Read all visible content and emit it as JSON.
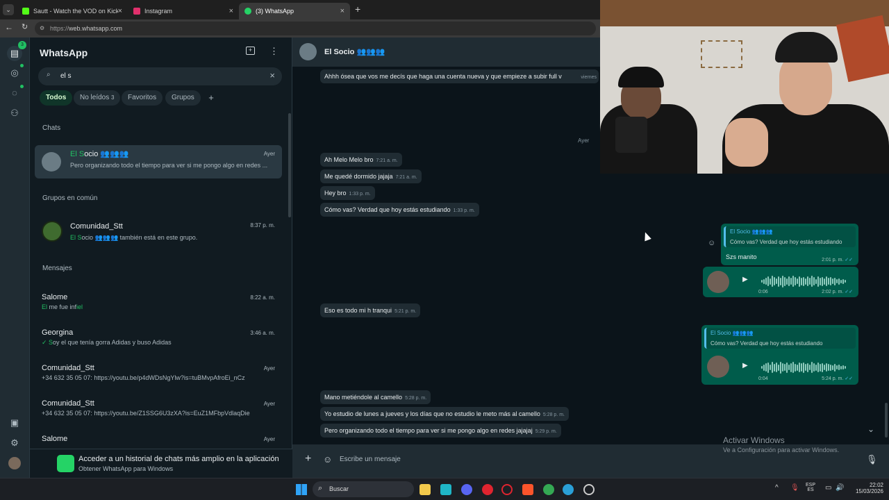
{
  "browser": {
    "tabs": [
      {
        "label": "Sautt - Watch the VOD on Kick",
        "color": "#53fc18"
      },
      {
        "label": "Instagram",
        "color": "#e1306c"
      },
      {
        "label": "(3) WhatsApp",
        "color": "#25d366"
      }
    ],
    "url_prefix": "https://",
    "url_host": "web.whatsapp.com"
  },
  "rail": {
    "badge": "3"
  },
  "sidebar": {
    "title": "WhatsApp",
    "search_value": "el s",
    "filters": [
      {
        "label": "Todos"
      },
      {
        "label": "No leídos",
        "count": "3"
      },
      {
        "label": "Favoritos"
      },
      {
        "label": "Grupos"
      }
    ],
    "sections": {
      "chats": "Chats",
      "groups": "Grupos en común",
      "messages": "Mensajes"
    },
    "chats": [
      {
        "name_hl": "El S",
        "name_rest": "ocio 👥👥👥",
        "time": "Ayer",
        "preview": "Pero organizando todo el tiempo para ver si me pongo algo en redes ..."
      }
    ],
    "groups": [
      {
        "name": "Comunidad_Stt",
        "time": "8:37 p. m.",
        "preview_hl": "El S",
        "preview_mid": "ocio 👥👥👥",
        "preview_rest": " también está en este grupo."
      }
    ],
    "messages": [
      {
        "name": "Salome",
        "time": "8:22 a. m.",
        "p1": "El",
        "p2": " me fue inf",
        "p3": "iel"
      },
      {
        "name": "Georgina",
        "time": "3:46 a. m.",
        "p1": "✓ S",
        "p2": "oy el que tenía gorra Adidas y buso Adidas",
        "p3": ""
      },
      {
        "name": "Comunidad_Stt",
        "time": "Ayer",
        "p1": "+34 632 35 05 07: https://youtu.be/p4dWDsNgYlw?is=tuBMvpAfroEi_nCz",
        "p2": "",
        "p3": ""
      },
      {
        "name": "Comunidad_Stt",
        "time": "Ayer",
        "p1": "+34 632 35 05 07: https://youtu.be/Z1SSG6U3zXA?is=EuZ1MFbpVdlaqDie",
        "p2": "",
        "p3": ""
      },
      {
        "name": "Salome",
        "time": "Ayer",
        "p1": "",
        "p2": "",
        "p3": ""
      }
    ],
    "promo": {
      "title": "Acceder a un historial de chats más amplio en la aplicación",
      "sub": "Obtener WhatsApp para Windows"
    }
  },
  "chat": {
    "name": "El Socio 👥👥👥",
    "day_labels": [
      "viernes",
      "Ayer"
    ],
    "incoming": [
      {
        "text": "Ahhh ósea que vos me decís que haga una cuenta nueva y que empieze a subir full v",
        "time": ""
      },
      {
        "text": "Ah Melo Melo bro",
        "time": "7:21 a. m."
      },
      {
        "text": "Me quedé dormido jajaja",
        "time": "7:21 a. m."
      },
      {
        "text": "Hey bro",
        "time": "1:33 p. m."
      },
      {
        "text": "Cómo vas? Verdad que hoy estás estudiando",
        "time": "1:33 p. m."
      },
      {
        "text": "Eso es todo mi h tranqui",
        "time": "5:21 p. m."
      },
      {
        "text": "Mano metiéndole al camello",
        "time": "5:28 p. m."
      },
      {
        "text": "Yo estudio de lunes a jueves y los días que no estudio le meto más al camello",
        "time": "5:28 p. m."
      },
      {
        "text": "Pero organizando todo el tiempo para ver si me pongo algo en redes jajajaj",
        "time": "5:29 p. m."
      }
    ],
    "outgoing": [
      {
        "quote_name": "El Socio 👥👥👥",
        "quote_text": "Cómo vas? Verdad que hoy estás estudiando",
        "text": "Szs manito",
        "time": "2:01 p. m."
      },
      {
        "audio_dur": "0:06",
        "time": "2:02 p. m."
      },
      {
        "quote_name": "El Socio 👥👥👥",
        "quote_text": "Cómo vas? Verdad que hoy estás estudiando",
        "audio_dur": "0:04",
        "time": "5:24 p. m."
      }
    ],
    "composer_placeholder": "Escribe un mensaje"
  },
  "watermark": {
    "title": "Activar Windows",
    "sub": "Ve a Configuración para activar Windows."
  },
  "taskbar": {
    "search": "Buscar",
    "lang1": "ESP",
    "lang2": "ES",
    "time": "22:02",
    "date": "15/03/2026"
  }
}
